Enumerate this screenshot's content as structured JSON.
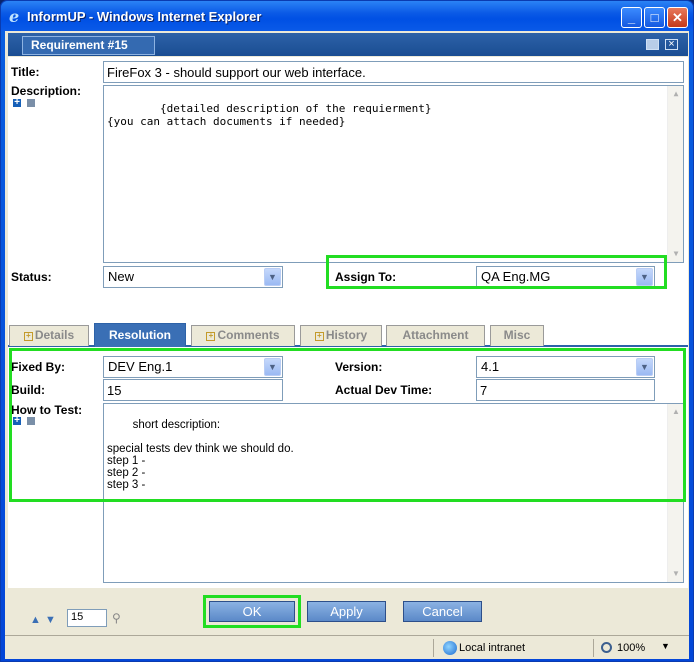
{
  "window": {
    "title": "InformUP - Windows Internet Explorer",
    "min_label": "_",
    "max_label": "□",
    "close_label": "✕"
  },
  "header": {
    "tab_label": "Requirement #15"
  },
  "form": {
    "title_label": "Title:",
    "title_value": "FireFox 3 - should support our web interface.",
    "description_label": "Description:",
    "description_value": "{detailed description of the requierment}\n{you can attach documents if needed}",
    "status_label": "Status:",
    "status_value": "New",
    "assign_label": "Assign To:",
    "assign_value": "QA Eng.MG"
  },
  "tabs": [
    {
      "label": "Details",
      "has_plus": true
    },
    {
      "label": "Resolution",
      "active": true
    },
    {
      "label": "Comments",
      "has_plus": true
    },
    {
      "label": "History",
      "has_plus": true
    },
    {
      "label": "Attachment"
    },
    {
      "label": "Misc"
    }
  ],
  "resolution": {
    "fixed_by_label": "Fixed By:",
    "fixed_by_value": "DEV Eng.1",
    "version_label": "Version:",
    "version_value": "4.1",
    "build_label": "Build:",
    "build_value": "15",
    "dev_time_label": "Actual Dev Time:",
    "dev_time_value": "7",
    "how_to_test_label": "How to Test:",
    "how_to_test_value": "short description:\n\nspecial tests dev think we should do.\nstep 1 -\nstep 2 -\nstep 3 -"
  },
  "footer": {
    "page_value": "15",
    "ok_label": "OK",
    "apply_label": "Apply",
    "cancel_label": "Cancel"
  },
  "statusbar": {
    "zone": "Local intranet",
    "zoom": "100%"
  },
  "colors": {
    "highlight": "#22dd22",
    "accent": "#2d62a8"
  }
}
